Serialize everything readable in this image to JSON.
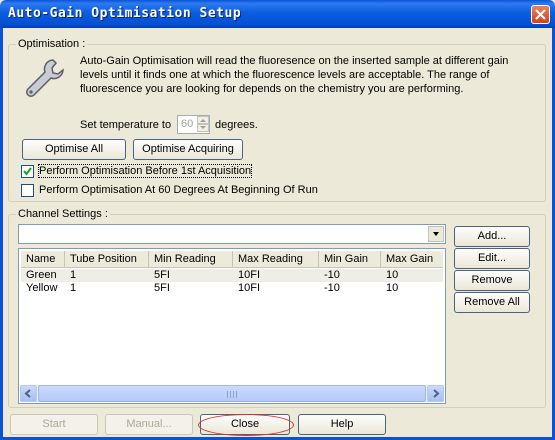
{
  "window": {
    "title": "Auto-Gain Optimisation Setup",
    "close_icon": "close-icon"
  },
  "optimisation": {
    "group_label": "Optimisation :",
    "icon": "wrench-icon",
    "description": "Auto-Gain Optimisation will read the fluoresence on the inserted sample at different gain levels until it finds one at which the fluorescence levels are acceptable. The range of fluorescence you are looking for depends on the chemistry you are performing.",
    "temp_label_before": "Set temperature to",
    "temp_value": "60",
    "temp_label_after": "degrees.",
    "optimise_all": "Optimise All",
    "optimise_acquiring": "Optimise Acquiring",
    "check_before_acquisition": {
      "label": "Perform Optimisation Before 1st Acquisition",
      "checked": true
    },
    "check_at_60": {
      "label": "Perform Optimisation At 60 Degrees At Beginning Of Run",
      "checked": false
    }
  },
  "channels": {
    "group_label": "Channel Settings :",
    "selected": "",
    "columns": [
      "Name",
      "Tube Position",
      "Min Reading",
      "Max Reading",
      "Min Gain",
      "Max Gain"
    ],
    "rows": [
      [
        "Green",
        "1",
        "5FI",
        "10FI",
        "-10",
        "10"
      ],
      [
        "Yellow",
        "1",
        "5FI",
        "10FI",
        "-10",
        "10"
      ]
    ],
    "add": "Add...",
    "edit": "Edit...",
    "remove": "Remove",
    "remove_all": "Remove All"
  },
  "footer": {
    "start": "Start",
    "manual": "Manual...",
    "close": "Close",
    "help": "Help"
  },
  "colors": {
    "titlebar": "#0a53d8",
    "dialog_bg": "#ece9d8",
    "highlight_circle": "#e0302a"
  }
}
